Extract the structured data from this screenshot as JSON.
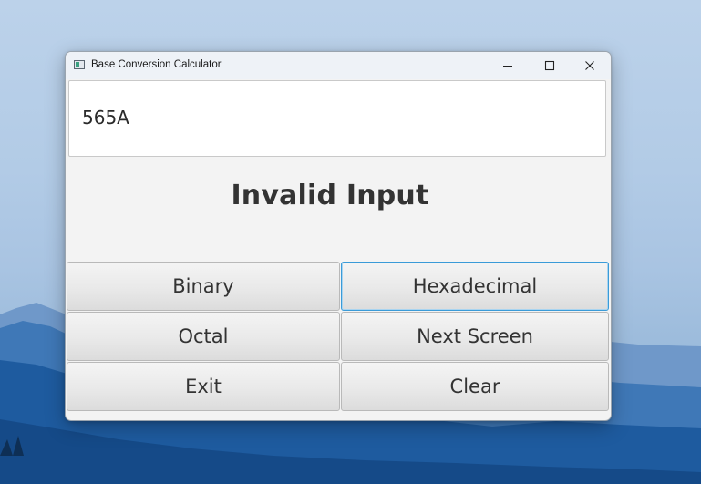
{
  "window": {
    "title": "Base Conversion Calculator"
  },
  "display": {
    "value": "565A"
  },
  "result": {
    "text": "Invalid Input"
  },
  "buttons": {
    "binary": "Binary",
    "hexadecimal": "Hexadecimal",
    "octal": "Octal",
    "next_screen": "Next Screen",
    "exit": "Exit",
    "clear": "Clear"
  },
  "state": {
    "focused_button": "hexadecimal"
  },
  "icons": {
    "app": "app-window-icon",
    "minimize": "minimize-icon",
    "maximize": "maximize-icon",
    "close": "close-icon"
  },
  "colors": {
    "focus_border": "#3a9bd8",
    "window_bg": "#f3f3f3",
    "text": "#333333"
  }
}
